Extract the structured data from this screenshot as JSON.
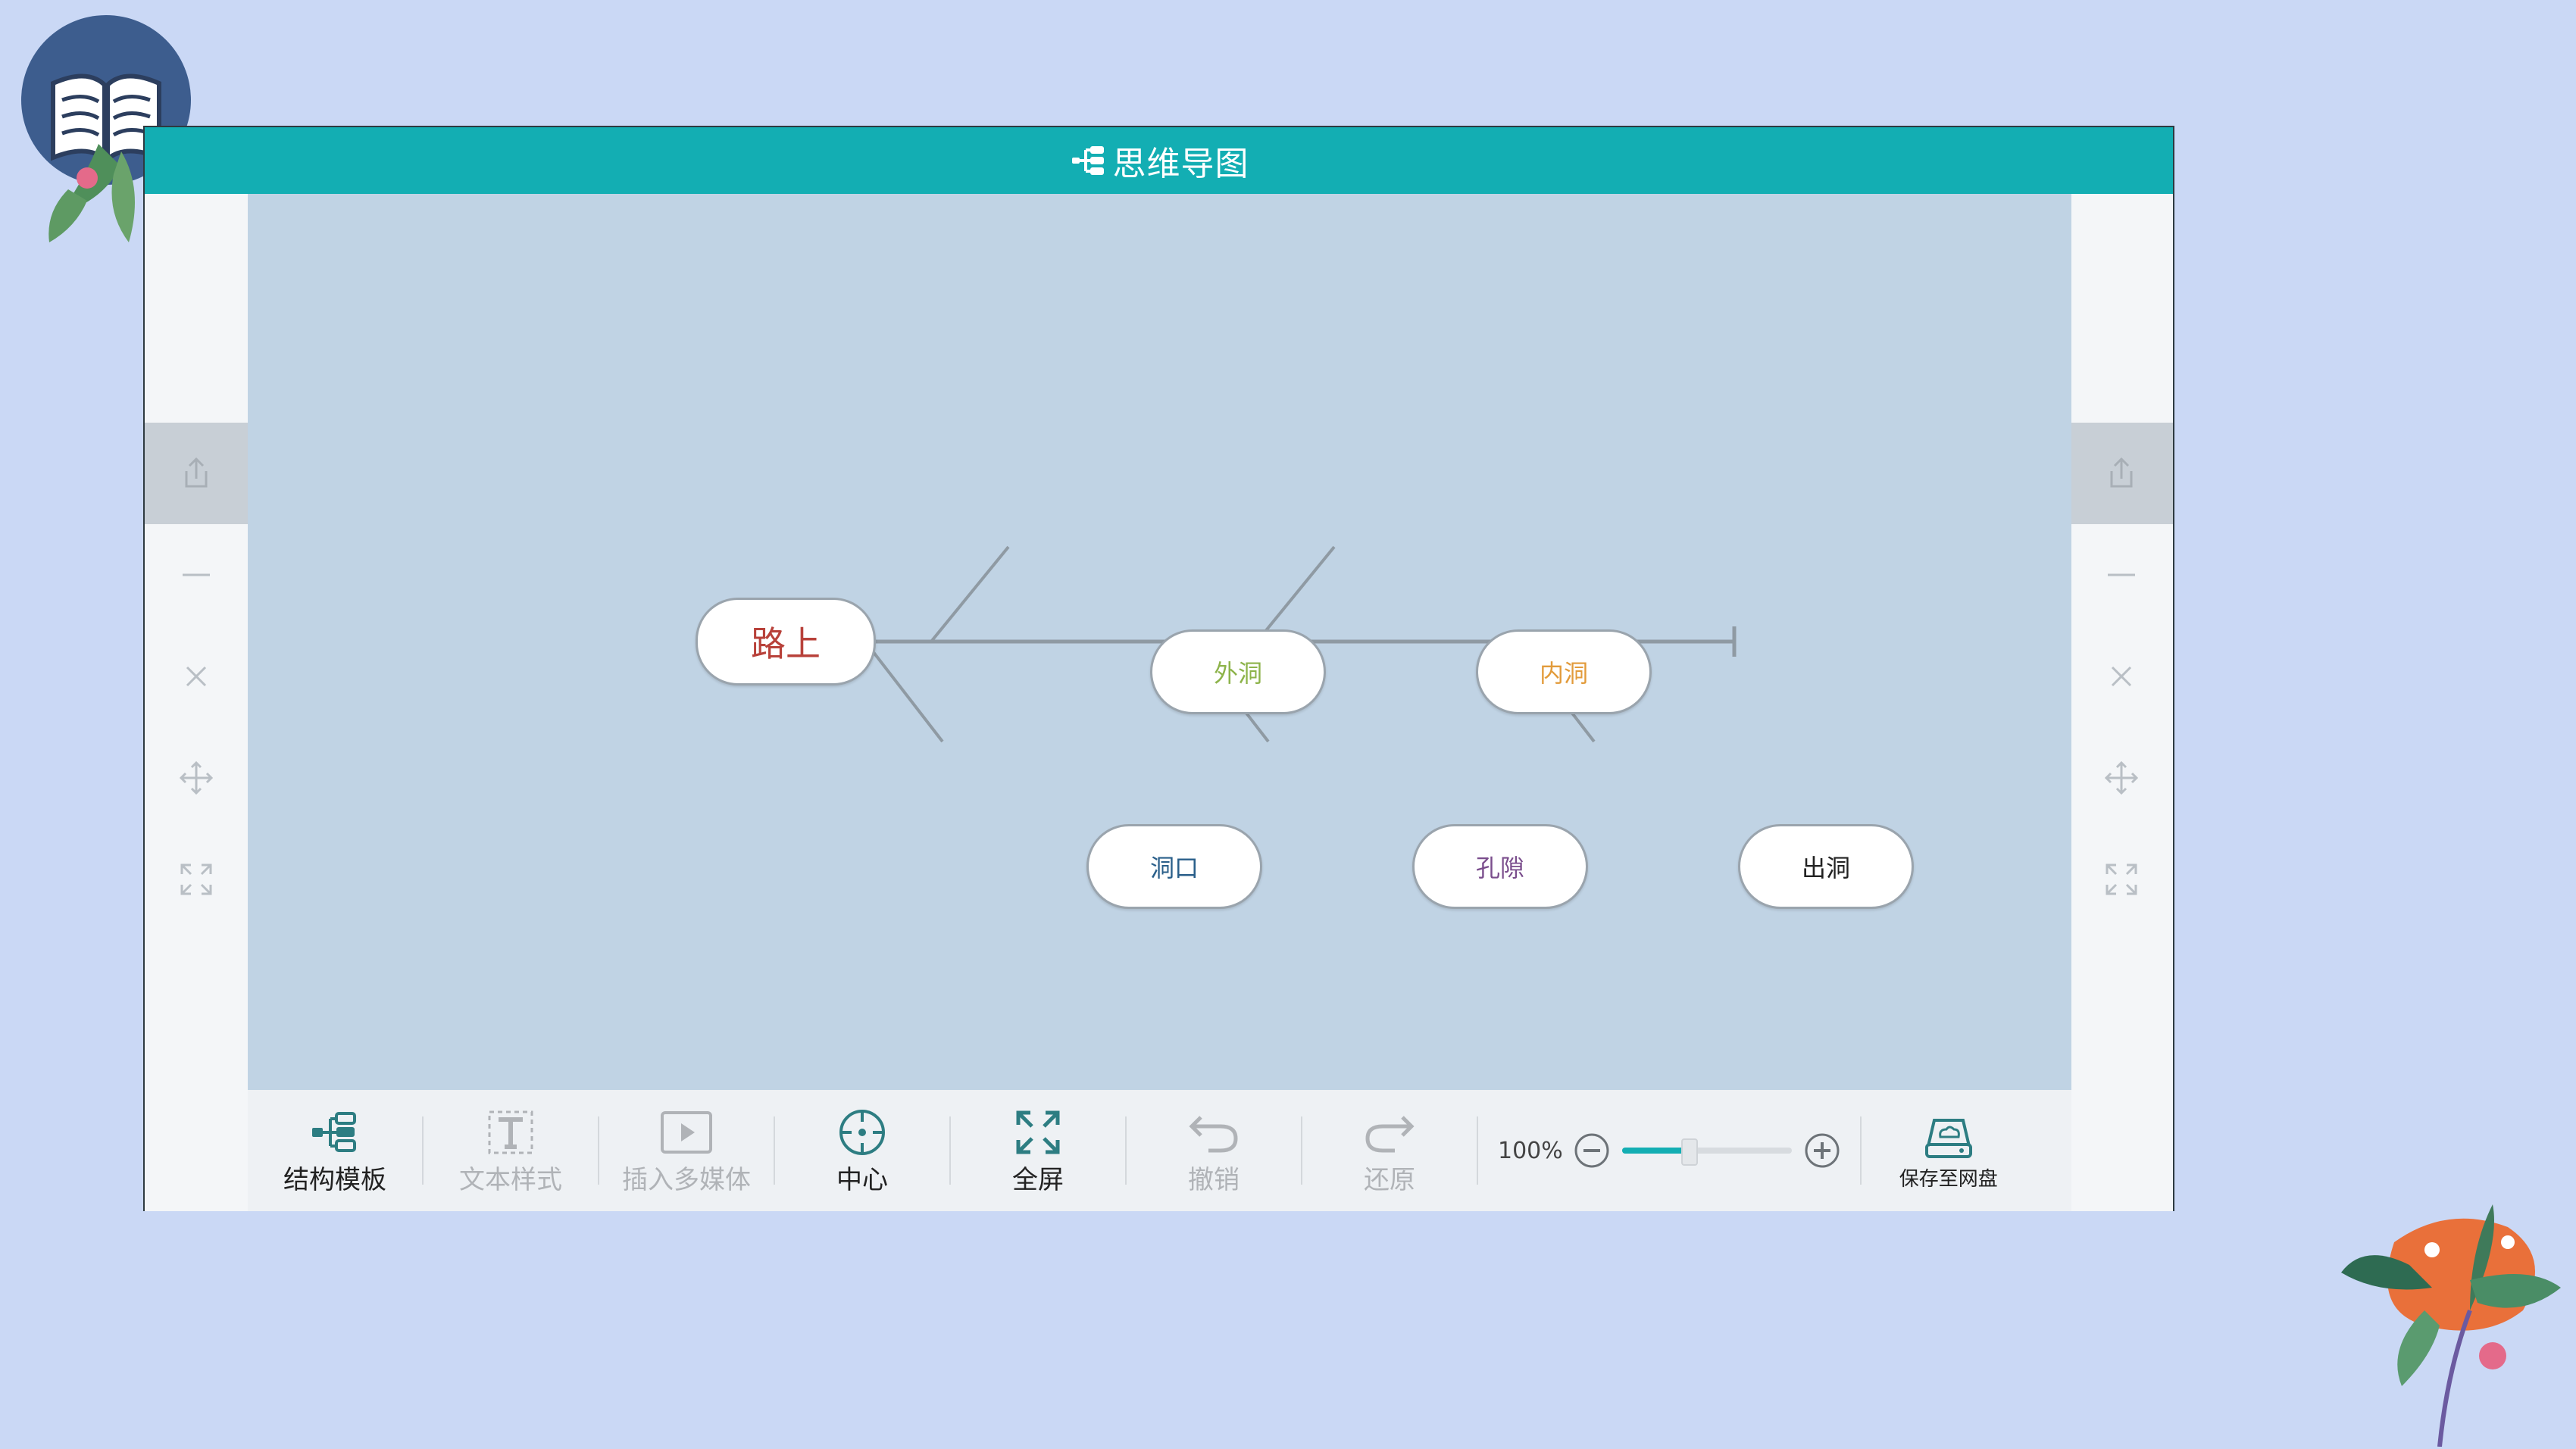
{
  "window": {
    "title": "思维导图"
  },
  "side_panel": {
    "buttons": [
      {
        "icon": "share-icon",
        "active": true
      },
      {
        "icon": "minus-icon",
        "active": false
      },
      {
        "icon": "close-icon",
        "active": false
      },
      {
        "icon": "move-icon",
        "active": false
      },
      {
        "icon": "expand-icon",
        "active": false
      }
    ]
  },
  "mindmap": {
    "type": "fishbone",
    "root": {
      "label": "路上",
      "color": "#b8413a"
    },
    "branches": [
      {
        "label": "外洞",
        "side": "top",
        "color": "#8db34a"
      },
      {
        "label": "洞口",
        "side": "bottom",
        "color": "#2a5f8a"
      },
      {
        "label": "内洞",
        "side": "top",
        "color": "#e29b3b"
      },
      {
        "label": "孔隙",
        "side": "bottom",
        "color": "#7a4d8c"
      },
      {
        "label": "出洞",
        "side": "bottom",
        "color": "#222222"
      }
    ]
  },
  "toolbar": {
    "structure_template": "结构模板",
    "text_style": "文本样式",
    "insert_media": "插入多媒体",
    "center": "中心",
    "fullscreen": "全屏",
    "undo": "撤销",
    "redo": "还原",
    "zoom_level": "100%",
    "zoom_slider_value": 0.4,
    "save_to_cloud": "保存至网盘"
  },
  "colors": {
    "accent": "#13aeb3",
    "canvas_bg": "#c0d3e4",
    "page_bg": "#cad8f5"
  }
}
